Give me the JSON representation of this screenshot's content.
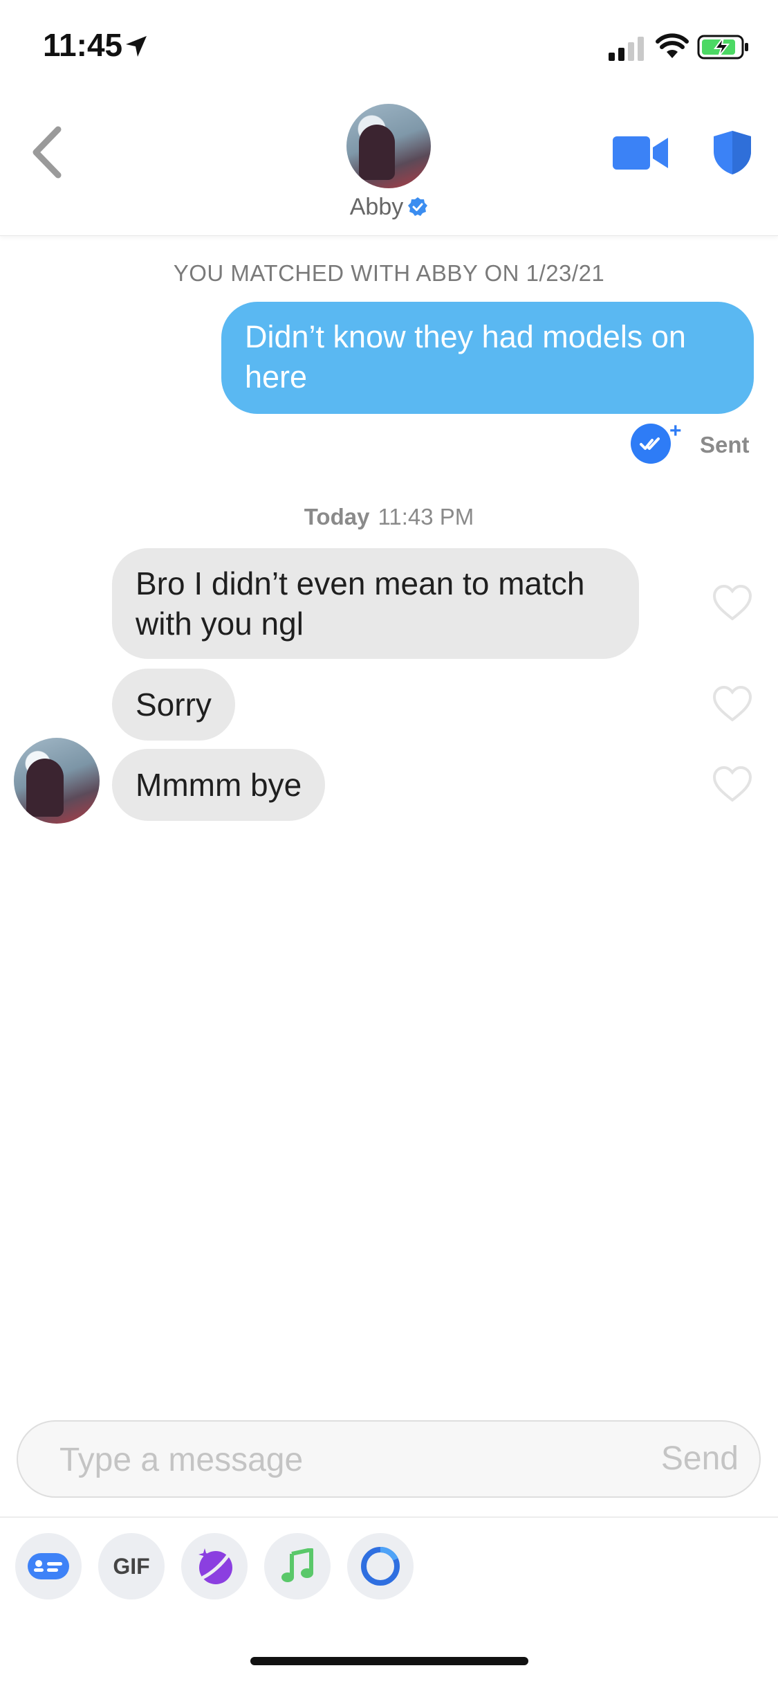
{
  "status_bar": {
    "time": "11:45"
  },
  "header": {
    "name": "Abby"
  },
  "chat": {
    "match_banner": "YOU MATCHED WITH ABBY ON 1/23/21",
    "sent_message": "Didn’t know they had models on here",
    "sent_status": "Sent",
    "day_label": "Today",
    "day_time": "11:43 PM",
    "received": [
      "Bro I didn’t even mean to match with you ngl",
      "Sorry",
      "Mmmm bye"
    ]
  },
  "composer": {
    "placeholder": "Type a message",
    "send_label": "Send"
  },
  "toolbar": {
    "gif_label": "GIF"
  },
  "colors": {
    "sent_bubble": "#5ab8f2",
    "received_bubble": "#e8e8e8",
    "accent_blue": "#3b82f6"
  }
}
